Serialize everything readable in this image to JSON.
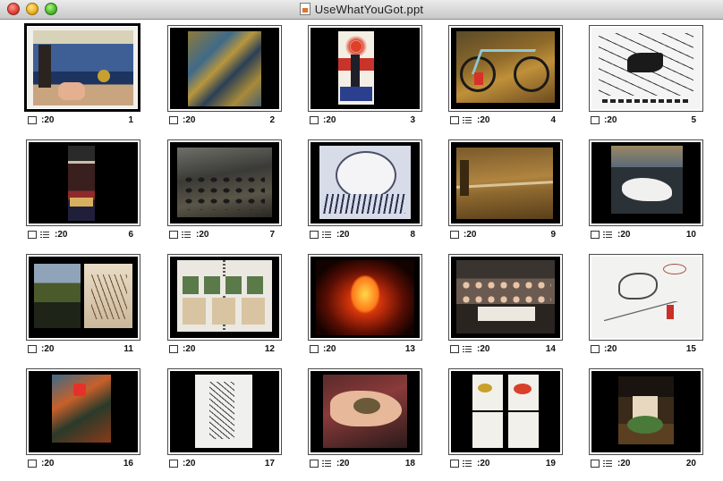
{
  "window": {
    "title": "UseWhatYouGot.ppt",
    "icons": [
      "close-button",
      "minimize-button",
      "zoom-button",
      "ppt-document-icon"
    ]
  },
  "slides": [
    {
      "number": "1",
      "timing": ":20",
      "has_build": false,
      "selected": true
    },
    {
      "number": "2",
      "timing": ":20",
      "has_build": false
    },
    {
      "number": "3",
      "timing": ":20",
      "has_build": false
    },
    {
      "number": "4",
      "timing": ":20",
      "has_build": true
    },
    {
      "number": "5",
      "timing": ":20",
      "has_build": false
    },
    {
      "number": "6",
      "timing": ":20",
      "has_build": true
    },
    {
      "number": "7",
      "timing": ":20",
      "has_build": true
    },
    {
      "number": "8",
      "timing": ":20",
      "has_build": true
    },
    {
      "number": "9",
      "timing": ":20",
      "has_build": false
    },
    {
      "number": "10",
      "timing": ":20",
      "has_build": true
    },
    {
      "number": "11",
      "timing": ":20",
      "has_build": false
    },
    {
      "number": "12",
      "timing": ":20",
      "has_build": false
    },
    {
      "number": "13",
      "timing": ":20",
      "has_build": false
    },
    {
      "number": "14",
      "timing": ":20",
      "has_build": true
    },
    {
      "number": "15",
      "timing": ":20",
      "has_build": false
    },
    {
      "number": "16",
      "timing": ":20",
      "has_build": false
    },
    {
      "number": "17",
      "timing": ":20",
      "has_build": false
    },
    {
      "number": "18",
      "timing": ":20",
      "has_build": true
    },
    {
      "number": "19",
      "timing": ":20",
      "has_build": true
    },
    {
      "number": "20",
      "timing": ":20",
      "has_build": true
    }
  ],
  "icons": {
    "transition": "transition-icon",
    "build": "build-icon"
  }
}
